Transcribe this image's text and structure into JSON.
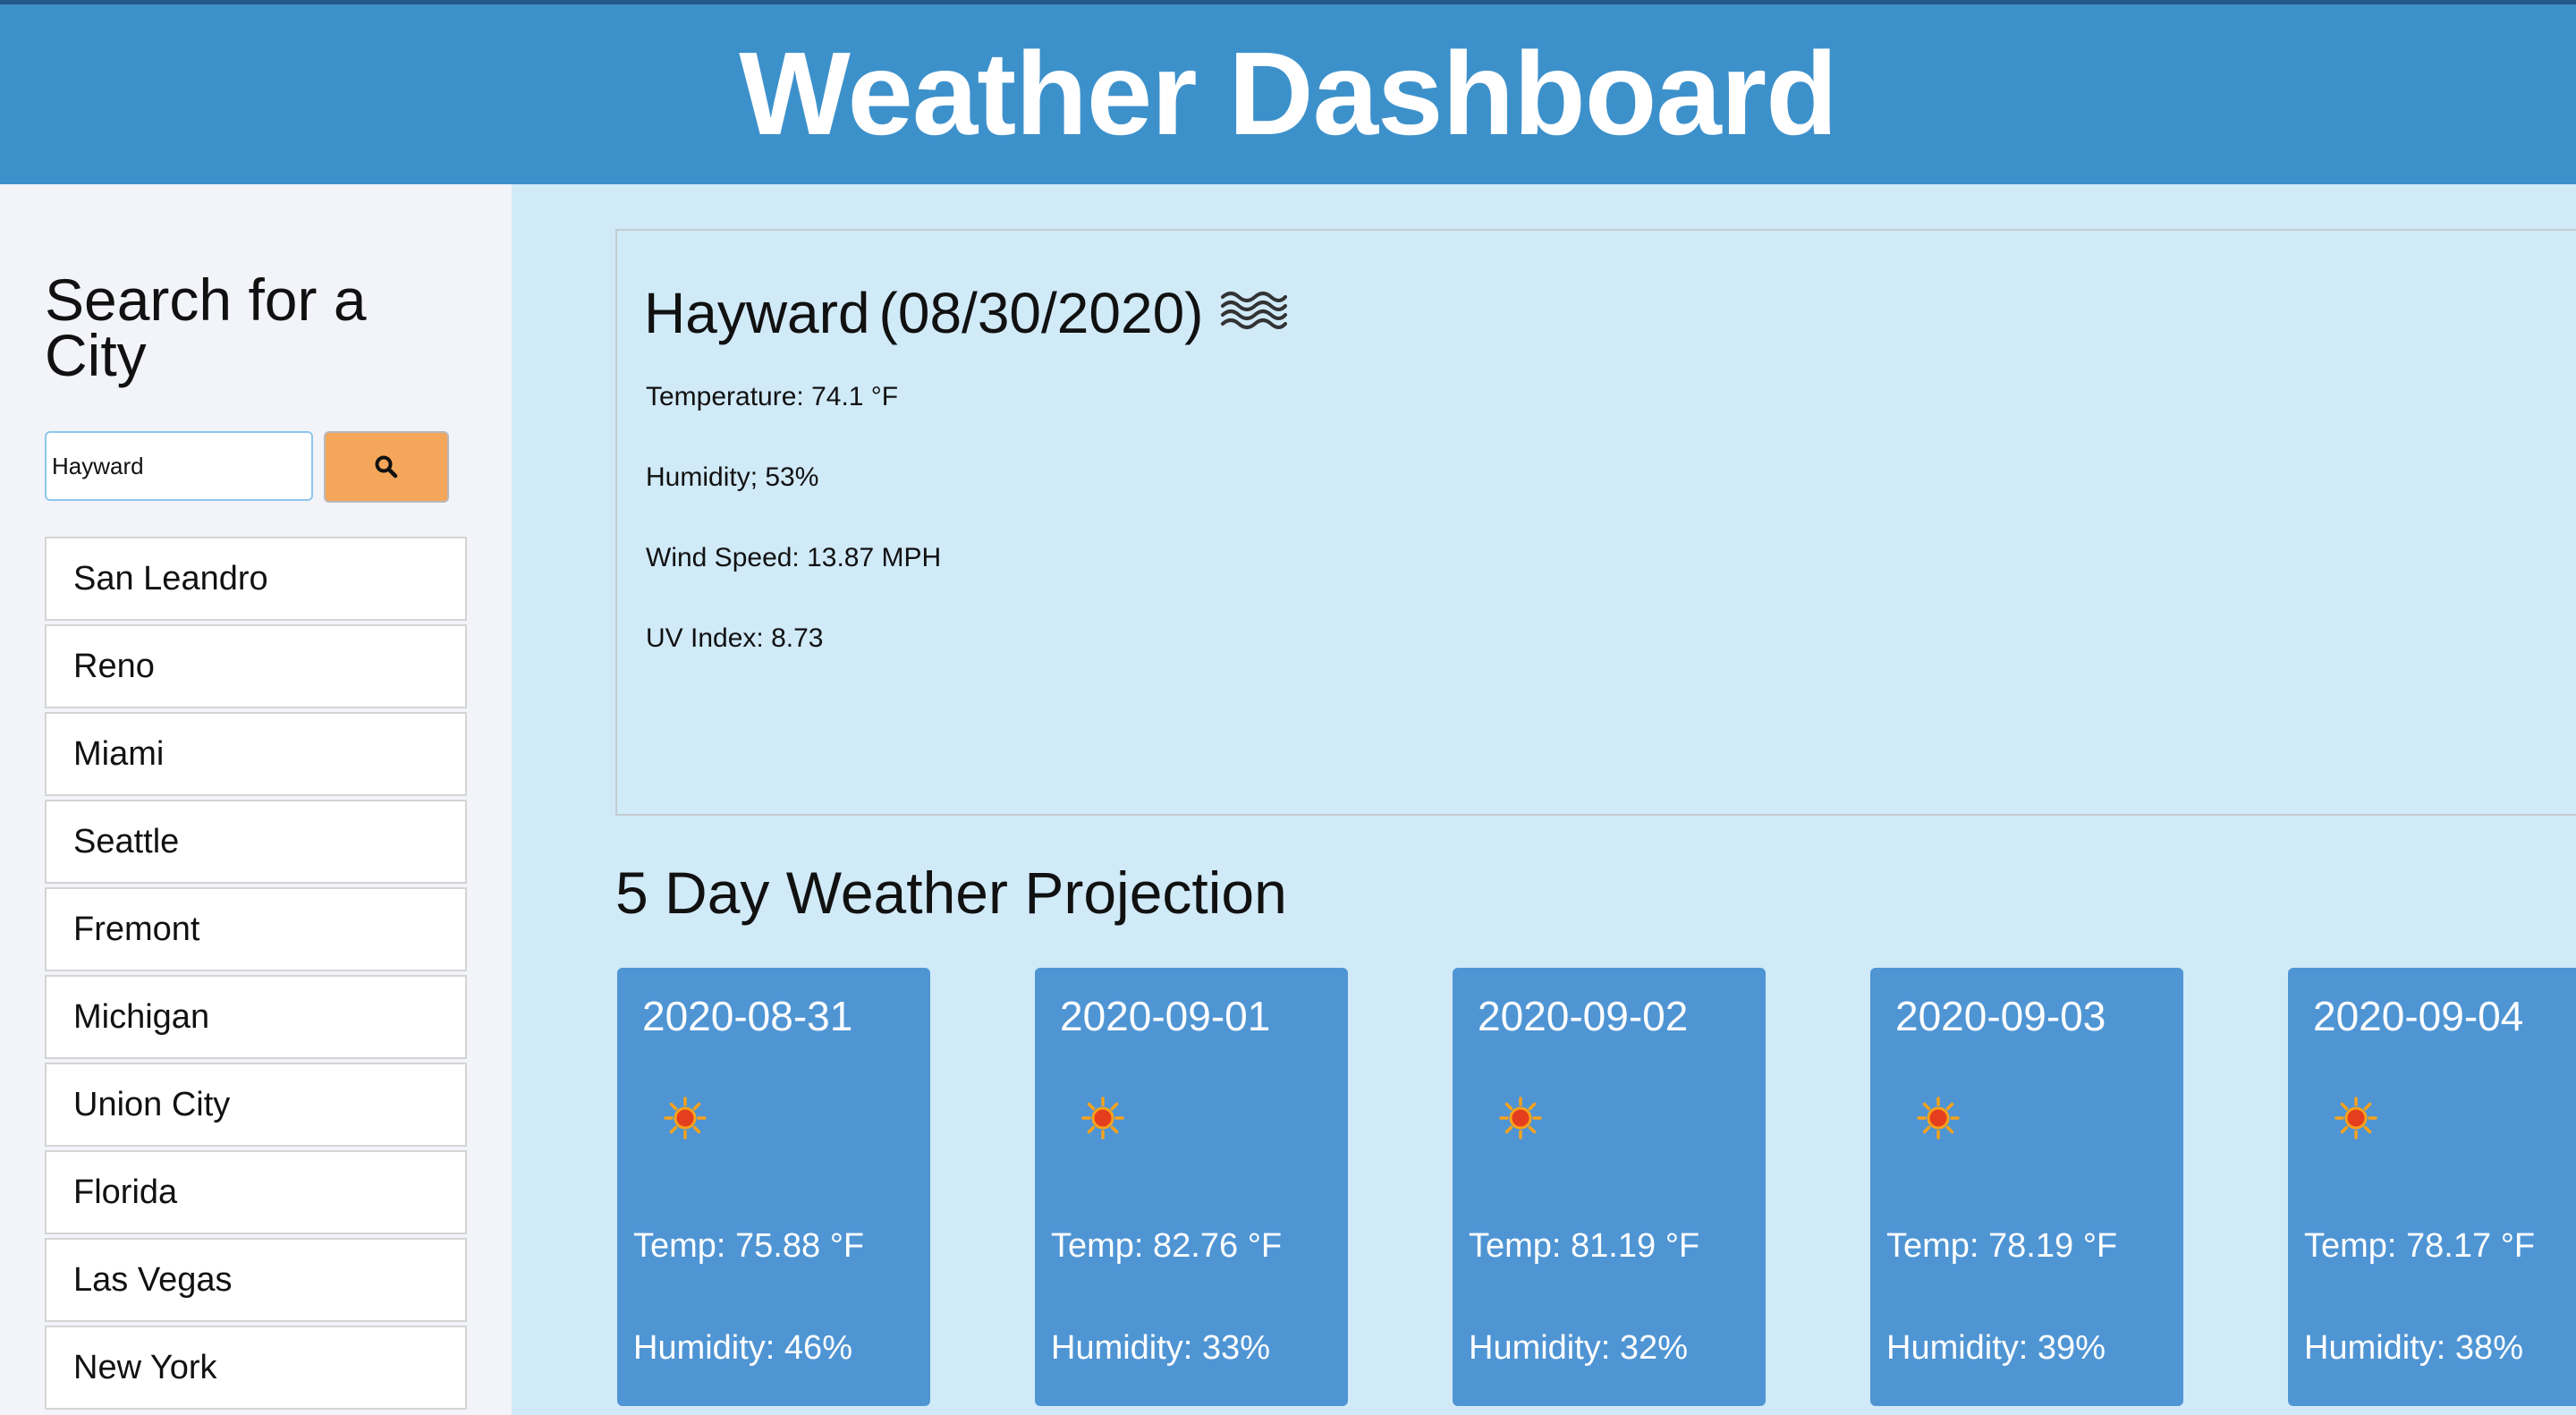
{
  "header": {
    "title": "Weather Dashboard"
  },
  "sidebar": {
    "heading": "Search for a City",
    "search": {
      "value": "Hayward",
      "button_icon": "search-icon"
    },
    "cities": [
      "San Leandro",
      "Reno",
      "Miami",
      "Seattle",
      "Fremont",
      "Michigan",
      "Union City",
      "Florida",
      "Las Vegas",
      "New York"
    ]
  },
  "current": {
    "city": "Hayward",
    "date": "(08/30/2020)",
    "icon": "haze-icon",
    "temperature": "Temperature: 74.1 °F",
    "humidity": "Humidity; 53%",
    "wind": "Wind Speed: 13.87 MPH",
    "uv": "UV Index: 8.73"
  },
  "forecast": {
    "title": "5 Day Weather Projection",
    "days": [
      {
        "date": "2020-08-31",
        "icon": "sun-icon",
        "temp": "Temp: 75.88 °F",
        "humidity": "Humidity: 46%"
      },
      {
        "date": "2020-09-01",
        "icon": "sun-icon",
        "temp": "Temp: 82.76 °F",
        "humidity": "Humidity: 33%"
      },
      {
        "date": "2020-09-02",
        "icon": "sun-icon",
        "temp": "Temp: 81.19 °F",
        "humidity": "Humidity: 32%"
      },
      {
        "date": "2020-09-03",
        "icon": "sun-icon",
        "temp": "Temp: 78.19 °F",
        "humidity": "Humidity: 39%"
      },
      {
        "date": "2020-09-04",
        "icon": "sun-icon",
        "temp": "Temp: 78.17 °F",
        "humidity": "Humidity: 38%"
      }
    ]
  },
  "colors": {
    "header": "#3d91cb",
    "page_background": "#d0eaf8",
    "sidebar": "#f2f4f9",
    "search_button": "#f4a65a",
    "card": "#4f95d4"
  }
}
